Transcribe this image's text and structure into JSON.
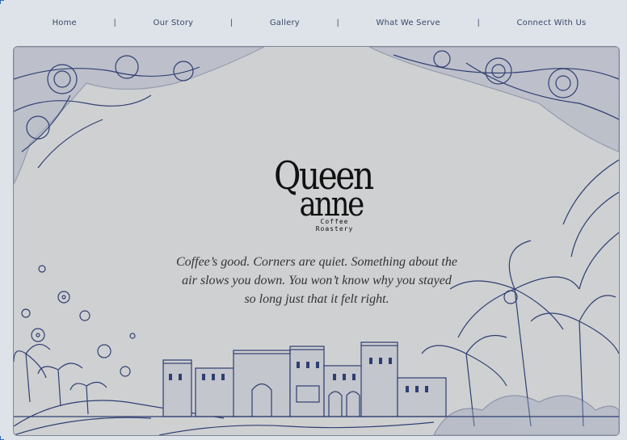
{
  "nav": {
    "items": [
      "Home",
      "Our Story",
      "Gallery",
      "What We Serve",
      "Connect With Us"
    ],
    "separator": "|"
  },
  "hero": {
    "logo_line1": "Queen",
    "logo_line2": "anne",
    "logo_sub": "Coffee Roastery",
    "tagline": "Coffee’s good. Corners are quiet. Something about the air slows you down. You won’t know why you stayed so long  just that it felt right."
  },
  "colors": {
    "background": "#dde3e8",
    "ink": "#2f3f73",
    "paper": "#cfd0d1",
    "nav_text": "#3a4a6b"
  }
}
